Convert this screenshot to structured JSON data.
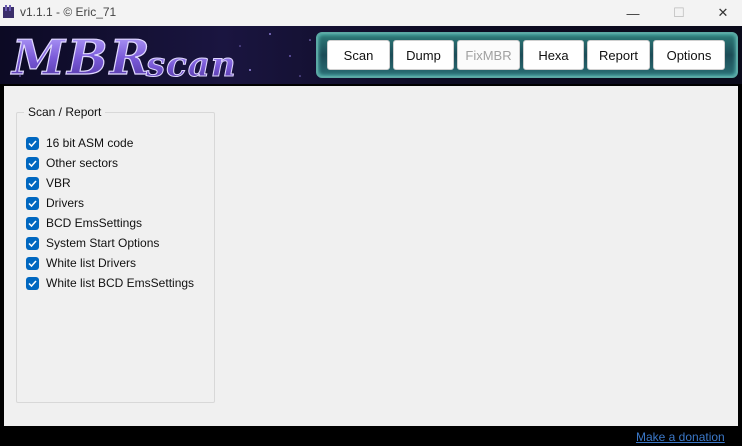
{
  "window": {
    "title": "v1.1.1 - © Eric_71",
    "min_glyph": "—",
    "max_glyph": "☐",
    "close_glyph": "✕"
  },
  "banner": {
    "logo_text": "MBRscan"
  },
  "toolbar": {
    "buttons": [
      {
        "label": "Scan",
        "enabled": true
      },
      {
        "label": "Dump",
        "enabled": true
      },
      {
        "label": "FixMBR",
        "enabled": false
      },
      {
        "label": "Hexa",
        "enabled": true
      },
      {
        "label": "Report",
        "enabled": true
      },
      {
        "label": "Options",
        "enabled": true
      }
    ]
  },
  "scan_report": {
    "title": "Scan / Report",
    "options": [
      {
        "label": "16 bit ASM code",
        "checked": true
      },
      {
        "label": "Other sectors",
        "checked": true
      },
      {
        "label": "VBR",
        "checked": true
      },
      {
        "label": "Drivers",
        "checked": true
      },
      {
        "label": "BCD EmsSettings",
        "checked": true
      },
      {
        "label": "System Start Options",
        "checked": true
      },
      {
        "label": "White list Drivers",
        "checked": true
      },
      {
        "label": "White list BCD EmsSettings",
        "checked": true
      }
    ]
  },
  "footer": {
    "donation_link": "Make a donation"
  },
  "colors": {
    "checkbox_accent": "#0067c0",
    "link": "#3b78c8",
    "toolbar_frame": "#2d7a78"
  }
}
